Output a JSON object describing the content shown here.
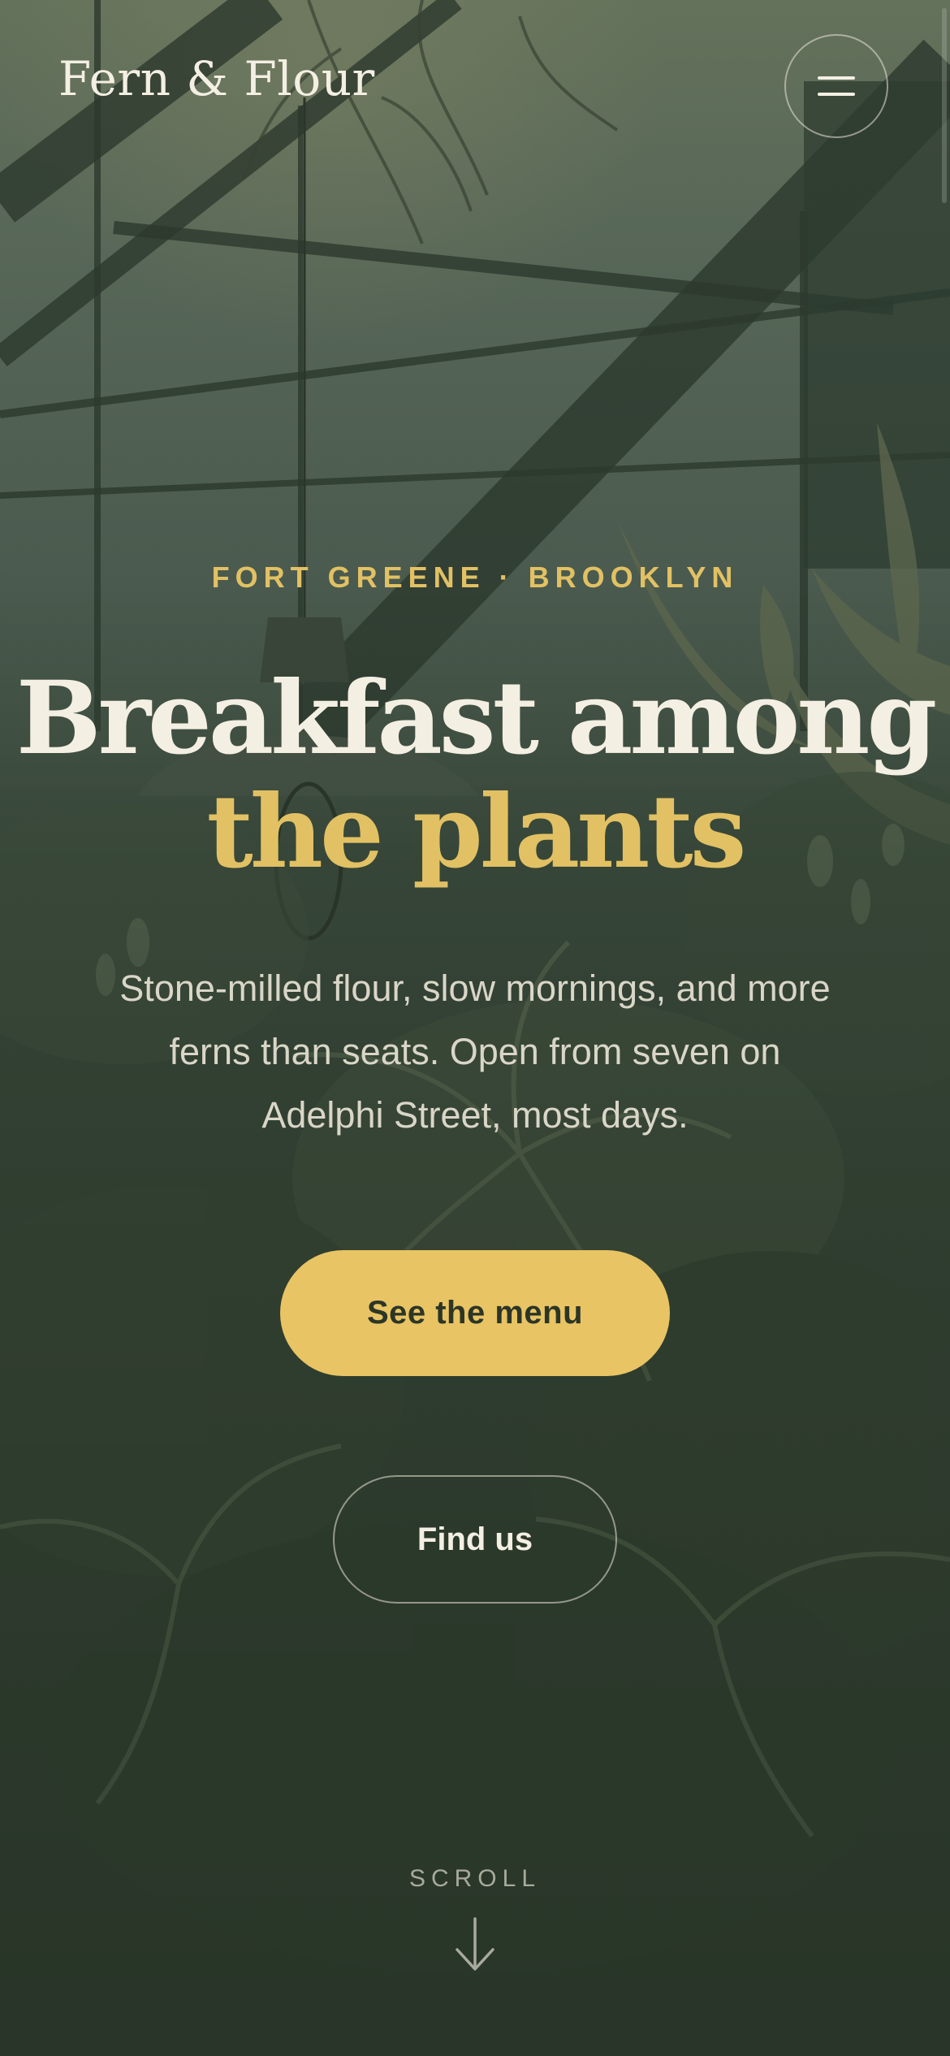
{
  "brand": {
    "name": "Fern & Flour"
  },
  "header": {
    "menu_icon": "hamburger-menu-icon"
  },
  "hero": {
    "eyebrow": "FORT GREENE · BROOKLYN",
    "headline_line1": "Breakfast among",
    "headline_line2": "the plants",
    "description": "Stone-milled flour, slow mornings, and more ferns than seats. Open from seven on Adelphi Street, most days.",
    "primary_cta": "See the menu",
    "secondary_cta": "Find us"
  },
  "scroll": {
    "label": "SCROLL",
    "icon": "arrow-down-icon"
  },
  "colors": {
    "accent": "#e8c464",
    "text_light": "#f4efe3",
    "background": "#2c3a2b"
  }
}
